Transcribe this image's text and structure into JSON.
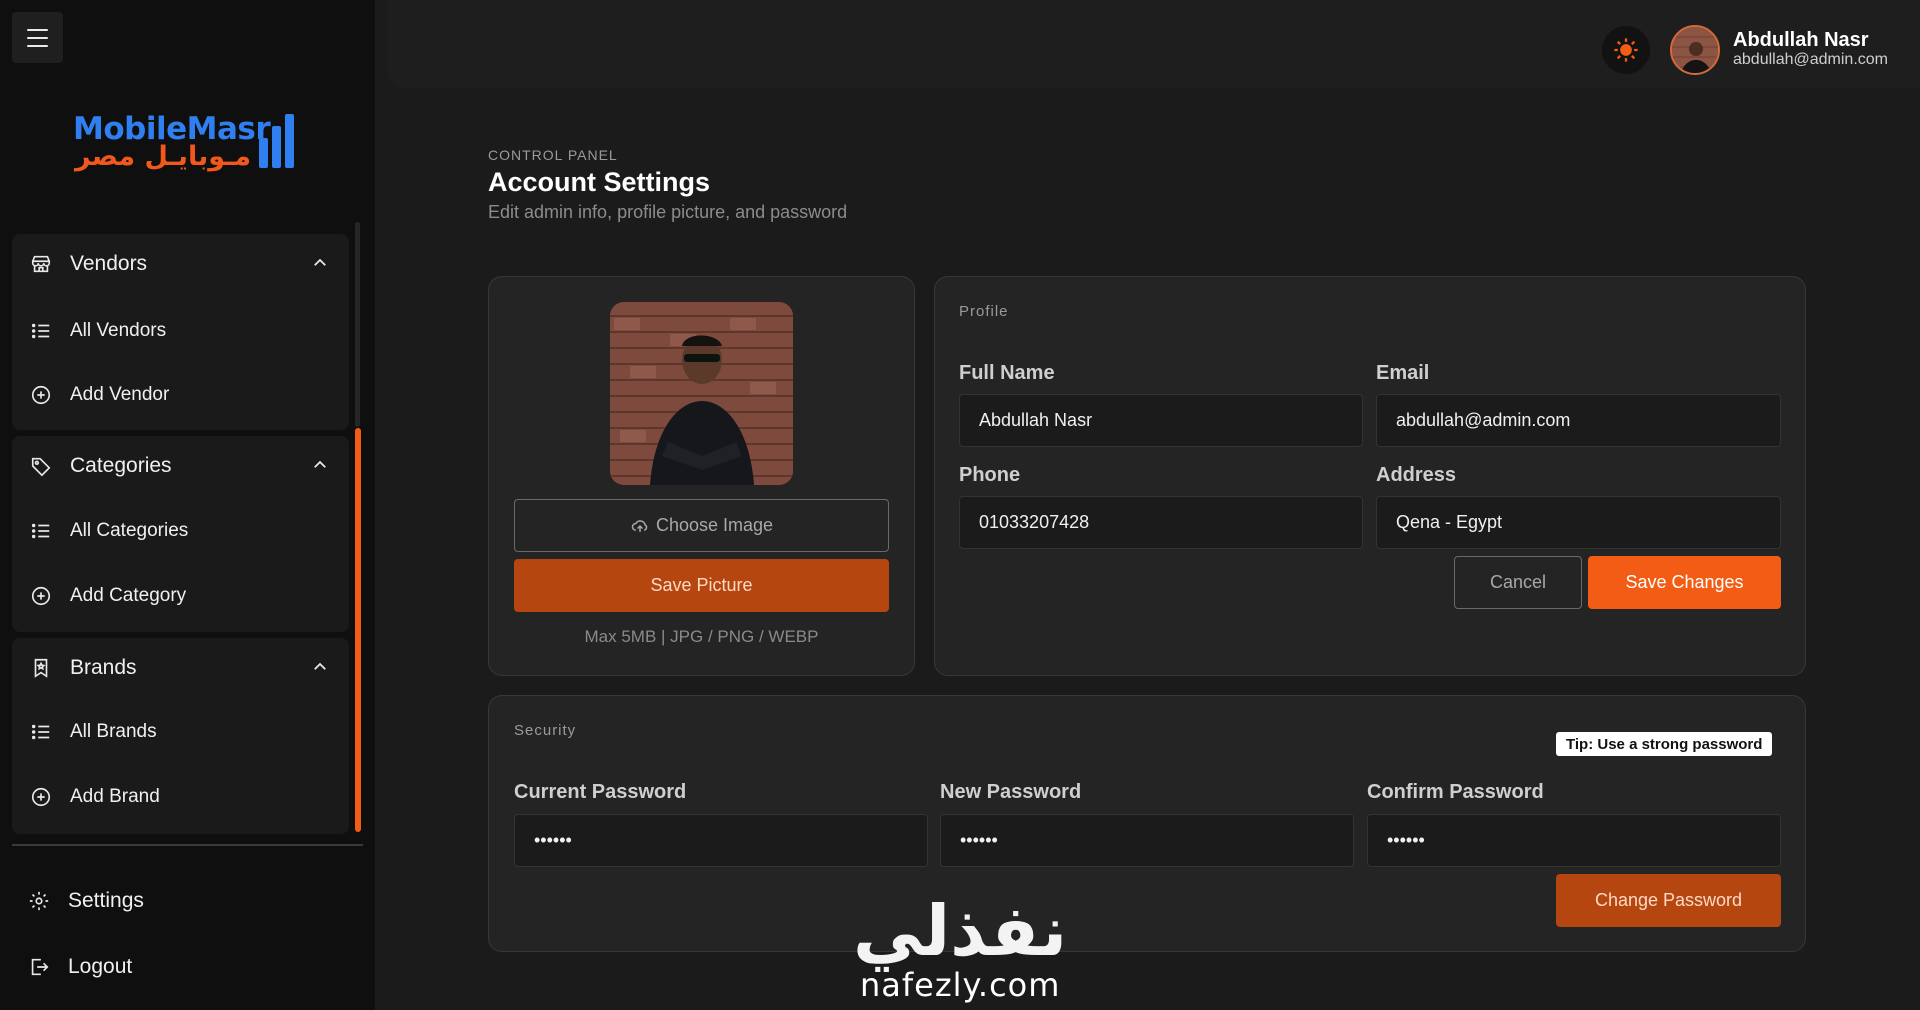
{
  "brand": {
    "name_en": "MobileMasr",
    "name_ar": "مـوبايـل مصر"
  },
  "sidebar": {
    "groups": [
      {
        "label": "Vendors",
        "items": [
          {
            "label": "All Vendors"
          },
          {
            "label": "Add Vendor"
          }
        ]
      },
      {
        "label": "Categories",
        "items": [
          {
            "label": "All Categories"
          },
          {
            "label": "Add Category"
          }
        ]
      },
      {
        "label": "Brands",
        "items": [
          {
            "label": "All Brands"
          },
          {
            "label": "Add Brand"
          }
        ]
      }
    ],
    "settings_label": "Settings",
    "logout_label": "Logout"
  },
  "user": {
    "name": "Abdullah Nasr",
    "email": "abdullah@admin.com"
  },
  "header": {
    "breadcrumb": "CONTROL PANEL",
    "title": "Account Settings",
    "subtitle": "Edit admin info, profile picture, and password"
  },
  "picture": {
    "choose_label": "Choose Image",
    "save_label": "Save Picture",
    "hint": "Max 5MB | JPG / PNG / WEBP"
  },
  "profile": {
    "section_title": "Profile",
    "full_name": {
      "label": "Full Name",
      "value": "Abdullah Nasr"
    },
    "email": {
      "label": "Email",
      "value": "abdullah@admin.com"
    },
    "phone": {
      "label": "Phone",
      "value": "01033207428"
    },
    "address": {
      "label": "Address",
      "value": "Qena - Egypt"
    },
    "cancel_label": "Cancel",
    "save_label": "Save Changes"
  },
  "security": {
    "section_title": "Security",
    "tip": "Tip: Use a strong password",
    "current": {
      "label": "Current Password",
      "value": "••••••"
    },
    "new": {
      "label": "New Password",
      "value": "••••••"
    },
    "confirm": {
      "label": "Confirm Password",
      "value": "••••••"
    },
    "change_label": "Change Password"
  },
  "watermark": {
    "ar": "نفذلي",
    "en": "nafezly.com"
  },
  "colors": {
    "accent": "#f25c14",
    "accent_dark": "#b6460f",
    "brand_blue": "#2f7ff0",
    "bg": "#1b1b1b",
    "card": "#242424",
    "sidebar": "#0f0f0f"
  },
  "icons": {
    "menu": "hamburger-icon",
    "vendors": "store-icon",
    "categories": "tag-icon",
    "brands": "bookmark-icon",
    "list": "list-icon",
    "add": "plus-circle-icon",
    "chevron": "chevron-up-icon",
    "settings": "gear-icon",
    "logout": "logout-icon",
    "theme": "sun-icon",
    "upload": "cloud-upload-icon"
  }
}
